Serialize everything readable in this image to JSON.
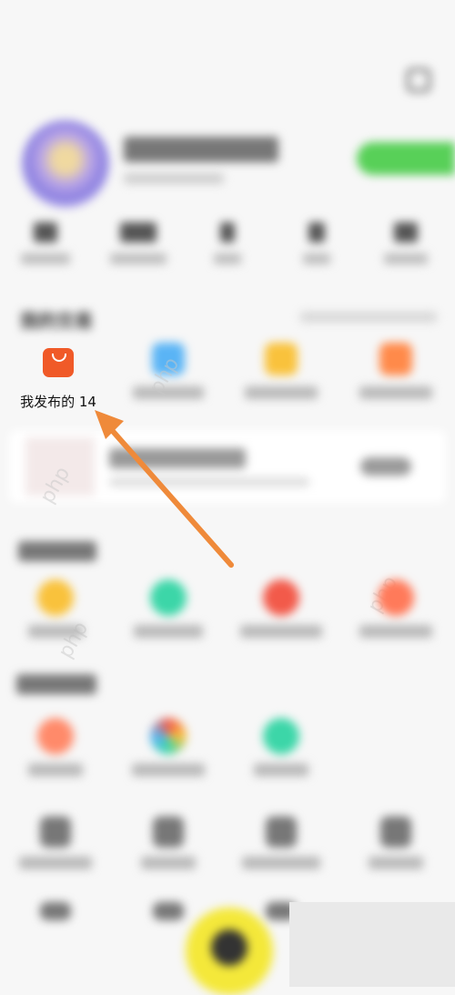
{
  "section": {
    "my_trade": "我的交易"
  },
  "trade_items": [
    {
      "label": "我发布的 14",
      "icon": "shopping-bag-icon",
      "color": "#f05a28"
    },
    {
      "icon": "blue-circle-icon",
      "color": "#5ab4f5"
    },
    {
      "icon": "yellow-circle-icon",
      "color": "#f9c23c"
    },
    {
      "icon": "orange-circle-icon",
      "color": "#ff8a4a"
    }
  ],
  "colors": {
    "accent_orange": "#f05a28",
    "arrow": "#ef8a3a",
    "fab": "#f4e83a",
    "vip_green": "#58d058"
  },
  "watermark": "php"
}
